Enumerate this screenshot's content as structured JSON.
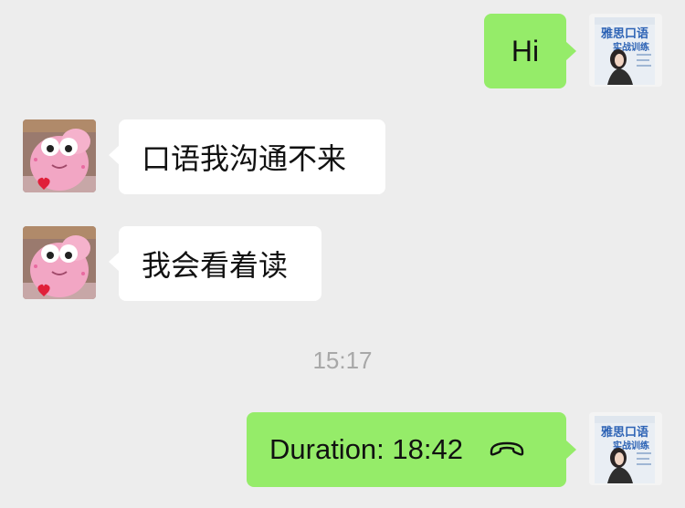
{
  "messages": [
    {
      "side": "out",
      "text": "Hi",
      "avatar": "book-cover-avatar"
    },
    {
      "side": "in",
      "text": "口语我沟通不来",
      "avatar": "pink-cartoon-avatar"
    },
    {
      "side": "in",
      "text": "我会看着读",
      "avatar": "pink-cartoon-avatar"
    }
  ],
  "timestamp": "15:17",
  "call": {
    "text": "Duration: 18:42",
    "icon": "hang-up-phone-icon"
  },
  "book_avatar": {
    "title_line1": "雅思口语",
    "title_line2": "实战训练"
  },
  "colors": {
    "background": "#ededed",
    "outgoing": "#95ec69",
    "incoming": "#ffffff"
  }
}
